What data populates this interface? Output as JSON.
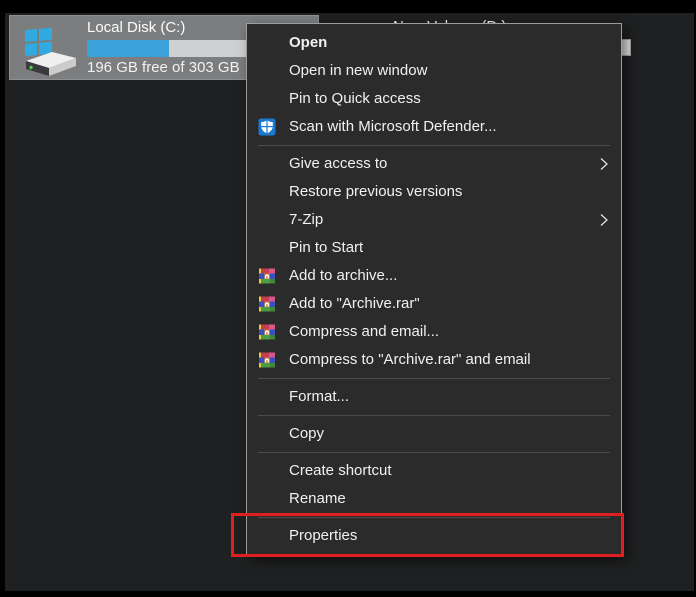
{
  "colors": {
    "page_bg": "#1f2021",
    "frame": "#000000",
    "tile_selected_bg": "#7b7d7f",
    "usage_bar_fill": "#3ba1d9",
    "usage_bar_track": "#cfd0d1",
    "menu_bg": "#2b2b2b",
    "menu_border": "#9d9d9d",
    "menu_text": "#f1f1f1",
    "annotation_red": "#e02020",
    "defender_blue": "#1879d2"
  },
  "drive_tile": {
    "name": "Local Disk (C:)",
    "usage_caption": "196 GB free of 303 GB",
    "used_percent": 36.5
  },
  "second_tile": {
    "name": "New Volume (D:)"
  },
  "context_menu": {
    "groups": [
      {
        "items": [
          {
            "label": "Open",
            "bold": true
          },
          {
            "label": "Open in new window"
          },
          {
            "label": "Pin to Quick access"
          },
          {
            "label": "Scan with Microsoft Defender...",
            "icon": "defender-shield"
          }
        ]
      },
      {
        "items": [
          {
            "label": "Give access to",
            "submenu": true
          },
          {
            "label": "Restore previous versions"
          },
          {
            "label": "7-Zip",
            "submenu": true
          },
          {
            "label": "Pin to Start"
          },
          {
            "label": "Add to archive...",
            "icon": "winrar"
          },
          {
            "label": "Add to \"Archive.rar\"",
            "icon": "winrar"
          },
          {
            "label": "Compress and email...",
            "icon": "winrar"
          },
          {
            "label": "Compress to \"Archive.rar\" and email",
            "icon": "winrar"
          }
        ]
      },
      {
        "items": [
          {
            "label": "Format..."
          }
        ]
      },
      {
        "items": [
          {
            "label": "Copy"
          }
        ]
      },
      {
        "items": [
          {
            "label": "Create shortcut"
          },
          {
            "label": "Rename"
          }
        ]
      },
      {
        "items": [
          {
            "label": "Properties",
            "annotated": true
          }
        ]
      }
    ]
  },
  "annotation": {
    "target": "Properties"
  }
}
